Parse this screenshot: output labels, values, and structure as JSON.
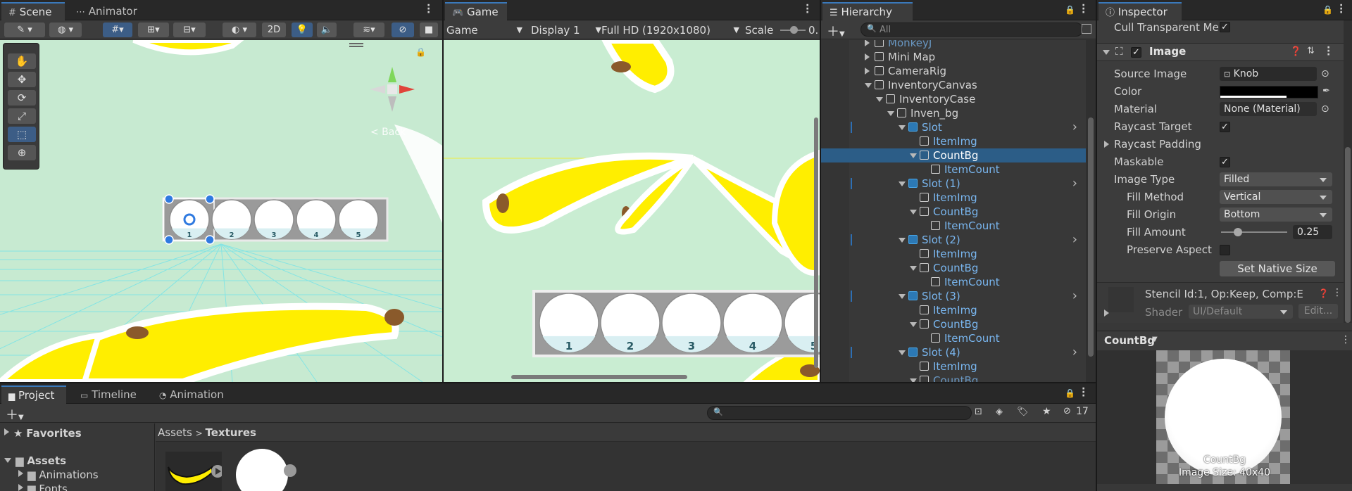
{
  "scene_panel": {
    "tabs": [
      "Scene",
      "Animator"
    ],
    "toolbar": {
      "mode_2d": "2D"
    },
    "gizmo": {
      "back_label": "< Back"
    },
    "slot_numbers": [
      "1",
      "2",
      "3",
      "4",
      "5"
    ]
  },
  "game_panel": {
    "tab": "Game",
    "toolbar": {
      "mode": "Game",
      "display": "Display 1",
      "resolution": "Full HD (1920x1080)",
      "scale_label": "Scale",
      "scale_value": "0."
    },
    "slot_numbers": [
      "1",
      "2",
      "3",
      "4",
      "5"
    ]
  },
  "hierarchy": {
    "tab": "Hierarchy",
    "search_placeholder": "All",
    "rows": [
      {
        "name": "MonkeyJ",
        "depth": 0,
        "expand": "right",
        "blue": true,
        "partial": true
      },
      {
        "name": "Mini Map",
        "depth": 0,
        "expand": "right",
        "blue": false
      },
      {
        "name": "CameraRig",
        "depth": 0,
        "expand": "right",
        "blue": false
      },
      {
        "name": "InventoryCanvas",
        "depth": 0,
        "expand": "down",
        "blue": false
      },
      {
        "name": "InventoryCase",
        "depth": 1,
        "expand": "down",
        "blue": false
      },
      {
        "name": "Inven_bg",
        "depth": 2,
        "expand": "down",
        "blue": false
      },
      {
        "name": "Slot",
        "depth": 3,
        "expand": "down",
        "blue": true,
        "prefab": true
      },
      {
        "name": "ItemImg",
        "depth": 4,
        "expand": "",
        "blue": true
      },
      {
        "name": "CountBg",
        "depth": 4,
        "expand": "down",
        "blue": true,
        "selected": true
      },
      {
        "name": "ItemCount",
        "depth": 5,
        "expand": "",
        "blue": true
      },
      {
        "name": "Slot (1)",
        "depth": 3,
        "expand": "down",
        "blue": true,
        "prefab": true
      },
      {
        "name": "ItemImg",
        "depth": 4,
        "expand": "",
        "blue": true
      },
      {
        "name": "CountBg",
        "depth": 4,
        "expand": "down",
        "blue": true
      },
      {
        "name": "ItemCount",
        "depth": 5,
        "expand": "",
        "blue": true
      },
      {
        "name": "Slot (2)",
        "depth": 3,
        "expand": "down",
        "blue": true,
        "prefab": true
      },
      {
        "name": "ItemImg",
        "depth": 4,
        "expand": "",
        "blue": true
      },
      {
        "name": "CountBg",
        "depth": 4,
        "expand": "down",
        "blue": true
      },
      {
        "name": "ItemCount",
        "depth": 5,
        "expand": "",
        "blue": true
      },
      {
        "name": "Slot (3)",
        "depth": 3,
        "expand": "down",
        "blue": true,
        "prefab": true
      },
      {
        "name": "ItemImg",
        "depth": 4,
        "expand": "",
        "blue": true
      },
      {
        "name": "CountBg",
        "depth": 4,
        "expand": "down",
        "blue": true
      },
      {
        "name": "ItemCount",
        "depth": 5,
        "expand": "",
        "blue": true
      },
      {
        "name": "Slot (4)",
        "depth": 3,
        "expand": "down",
        "blue": true,
        "prefab": true
      },
      {
        "name": "ItemImg",
        "depth": 4,
        "expand": "",
        "blue": true
      },
      {
        "name": "CountBg",
        "depth": 4,
        "expand": "down",
        "blue": true,
        "partial": true
      }
    ]
  },
  "inspector": {
    "tab": "Inspector",
    "cull_label": "Cull Transparent Me:",
    "component_title": "Image",
    "props": {
      "source_image_label": "Source Image",
      "source_image_value": "Knob",
      "color_label": "Color",
      "material_label": "Material",
      "material_value": "None (Material)",
      "raycast_target_label": "Raycast Target",
      "raycast_padding_label": "Raycast Padding",
      "maskable_label": "Maskable",
      "image_type_label": "Image Type",
      "image_type_value": "Filled",
      "fill_method_label": "Fill Method",
      "fill_method_value": "Vertical",
      "fill_origin_label": "Fill Origin",
      "fill_origin_value": "Bottom",
      "fill_amount_label": "Fill Amount",
      "fill_amount_value": "0.25",
      "preserve_aspect_label": "Preserve Aspect",
      "set_native_size": "Set Native Size"
    },
    "fill_amount": 0.25,
    "stencil_text": "Stencil Id:1, Op:Keep, Comp:E",
    "shader_label": "Shader",
    "shader_value": "UI/Default",
    "edit_label": "Edit...",
    "preview_title": "CountBg",
    "preview_name": "CountBg",
    "preview_size": "Image Size: 40x40"
  },
  "project": {
    "tabs": [
      "Project",
      "Timeline",
      "Animation"
    ],
    "hidden_count": "17",
    "favorites_label": "Favorites",
    "assets_label": "Assets",
    "folders": [
      "Animations",
      "Fonts"
    ],
    "breadcrumb": [
      "Assets",
      "Textures"
    ]
  },
  "colors": {
    "accent": "#3a79bb",
    "selection": "#2c5d87",
    "scene_bg": "#c9ecd2",
    "banana_yellow": "#ffee00"
  }
}
